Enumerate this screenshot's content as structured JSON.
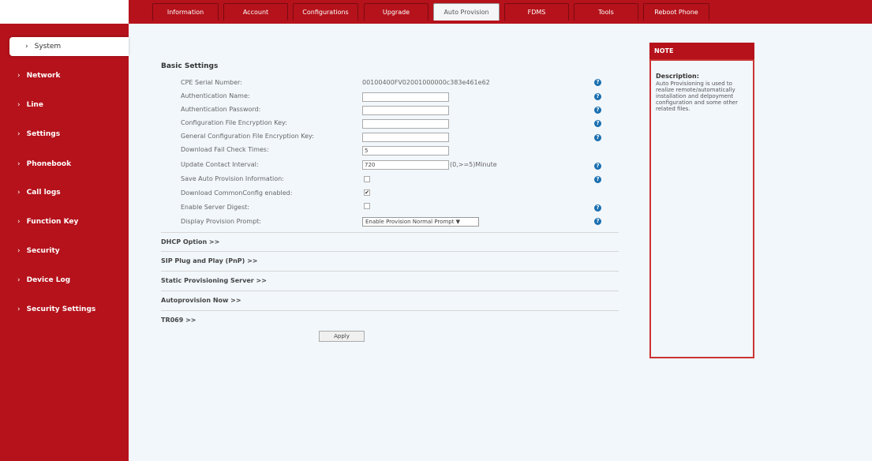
{
  "tabs": [
    {
      "label": "Information"
    },
    {
      "label": "Account"
    },
    {
      "label": "Configurations"
    },
    {
      "label": "Upgrade"
    },
    {
      "label": "Auto Provision"
    },
    {
      "label": "FDMS"
    },
    {
      "label": "Tools"
    },
    {
      "label": "Reboot Phone"
    }
  ],
  "sidebar": {
    "items": [
      {
        "label": "System"
      },
      {
        "label": "Network"
      },
      {
        "label": "Line"
      },
      {
        "label": "Settings"
      },
      {
        "label": "Phonebook"
      },
      {
        "label": "Call logs"
      },
      {
        "label": "Function Key"
      },
      {
        "label": "Security"
      },
      {
        "label": "Device Log"
      },
      {
        "label": "Security Settings"
      }
    ]
  },
  "basic": {
    "title": "Basic Settings",
    "rows": [
      {
        "label": "CPE Serial Number:",
        "value": "00100400FV02001000000c383e461e62"
      },
      {
        "label": "Authentication Name:",
        "value": ""
      },
      {
        "label": "Authentication Password:",
        "value": ""
      },
      {
        "label": "Configuration File Encryption Key:",
        "value": ""
      },
      {
        "label": "General Configuration File Encryption Key:",
        "value": ""
      },
      {
        "label": "Download Fail Check Times:",
        "value": "5"
      },
      {
        "label": "Update Contact Interval:",
        "value": "720",
        "suffix": "(0,>=5)Minute"
      },
      {
        "label": "Save Auto Provision Information:"
      },
      {
        "label": "Download CommonConfig enabled:"
      },
      {
        "label": "Enable Server Digest:"
      },
      {
        "label": "Display Provision Prompt:",
        "value": "Enable Provision Normal Prompt ▼"
      }
    ]
  },
  "sections": [
    {
      "label": "DHCP Option >>"
    },
    {
      "label": "SIP Plug and Play (PnP) >>"
    },
    {
      "label": "Static Provisioning Server >>"
    },
    {
      "label": "Autoprovision Now >>"
    },
    {
      "label": "TR069 >>"
    }
  ],
  "apply_label": "Apply",
  "note": {
    "head": "NOTE",
    "title": "Description:",
    "text": "Auto Provisioning is used to realize remote/automatically installation and delpoyment configuration and some other related files."
  },
  "help_glyph": "?",
  "check_glyph": "✔",
  "colors": {
    "brand": "#b5121b",
    "help": "#1a6fb0"
  }
}
